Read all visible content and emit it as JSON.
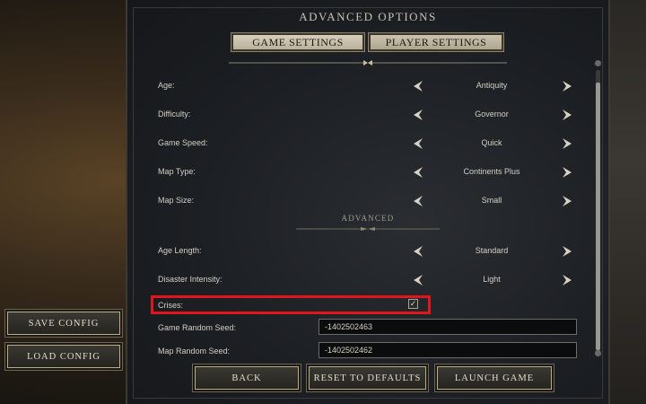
{
  "screen": {
    "title": "ADVANCED OPTIONS",
    "tabs": [
      {
        "label": "GAME SETTINGS",
        "active": true
      },
      {
        "label": "PLAYER SETTINGS",
        "active": false
      }
    ]
  },
  "settings": [
    {
      "label": "Age:",
      "value": "Antiquity"
    },
    {
      "label": "Difficulty:",
      "value": "Governor"
    },
    {
      "label": "Game Speed:",
      "value": "Quick"
    },
    {
      "label": "Map Type:",
      "value": "Continents Plus"
    },
    {
      "label": "Map Size:",
      "value": "Small"
    }
  ],
  "advanced": {
    "heading": "ADVANCED",
    "settings": [
      {
        "label": "Age Length:",
        "value": "Standard"
      },
      {
        "label": "Disaster Intensity:",
        "value": "Light"
      }
    ],
    "crises": {
      "label": "Crises:",
      "checked": true,
      "check_glyph": "✓"
    },
    "game_seed": {
      "label": "Game Random Seed:",
      "value": "-1402502463"
    },
    "map_seed": {
      "label": "Map Random Seed:",
      "value": "-1402502462"
    }
  },
  "buttons": {
    "back": "BACK",
    "reset": "RESET TO DEFAULTS",
    "launch": "LAUNCH GAME",
    "save_config": "SAVE CONFIG",
    "load_config": "LOAD CONFIG"
  },
  "icons": {
    "prev": "arrow-left-icon",
    "next": "arrow-right-icon"
  },
  "colors": {
    "highlight": "#e0161a",
    "panel": "#1c1f23",
    "button_border": "#b9ae8c"
  }
}
